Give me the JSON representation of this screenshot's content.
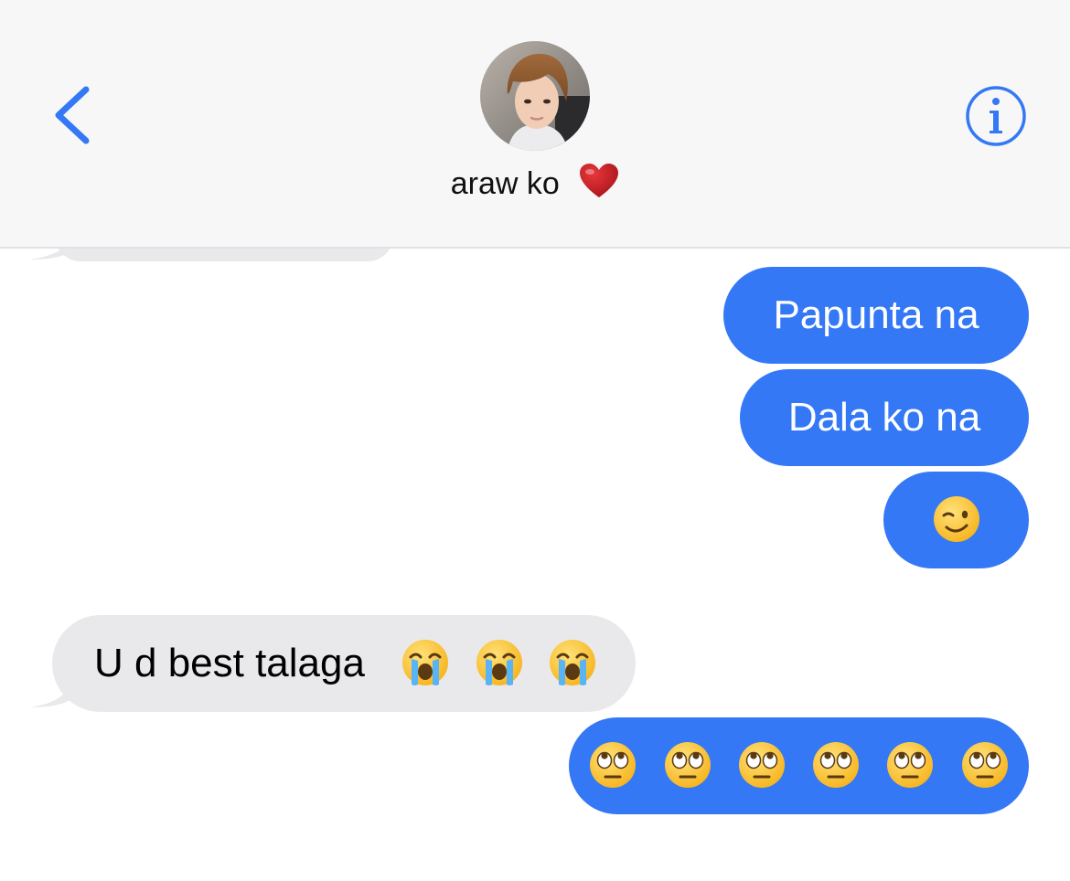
{
  "header": {
    "contact_name": "araw ko",
    "name_emoji_icon": "red-heart-icon",
    "back_icon": "chevron-left-icon",
    "info_icon": "info-circle-icon",
    "accent_color": "#3478f6"
  },
  "messages": [
    {
      "direction": "outgoing",
      "text": "Papunta na"
    },
    {
      "direction": "outgoing",
      "text": "Dala ko na"
    },
    {
      "direction": "outgoing",
      "text": "",
      "emojis": [
        "winking-face-icon"
      ]
    },
    {
      "direction": "incoming",
      "text": "U d best talaga",
      "emojis": [
        "loudly-crying-face-icon",
        "loudly-crying-face-icon",
        "loudly-crying-face-icon"
      ]
    },
    {
      "direction": "outgoing",
      "text": "",
      "emojis": [
        "face-with-rolling-eyes-icon",
        "face-with-rolling-eyes-icon",
        "face-with-rolling-eyes-icon",
        "face-with-rolling-eyes-icon",
        "face-with-rolling-eyes-icon",
        "face-with-rolling-eyes-icon"
      ]
    }
  ],
  "colors": {
    "outgoing_bubble": "#3478f6",
    "incoming_bubble": "#e9e9eb",
    "header_background": "#f7f7f7"
  }
}
